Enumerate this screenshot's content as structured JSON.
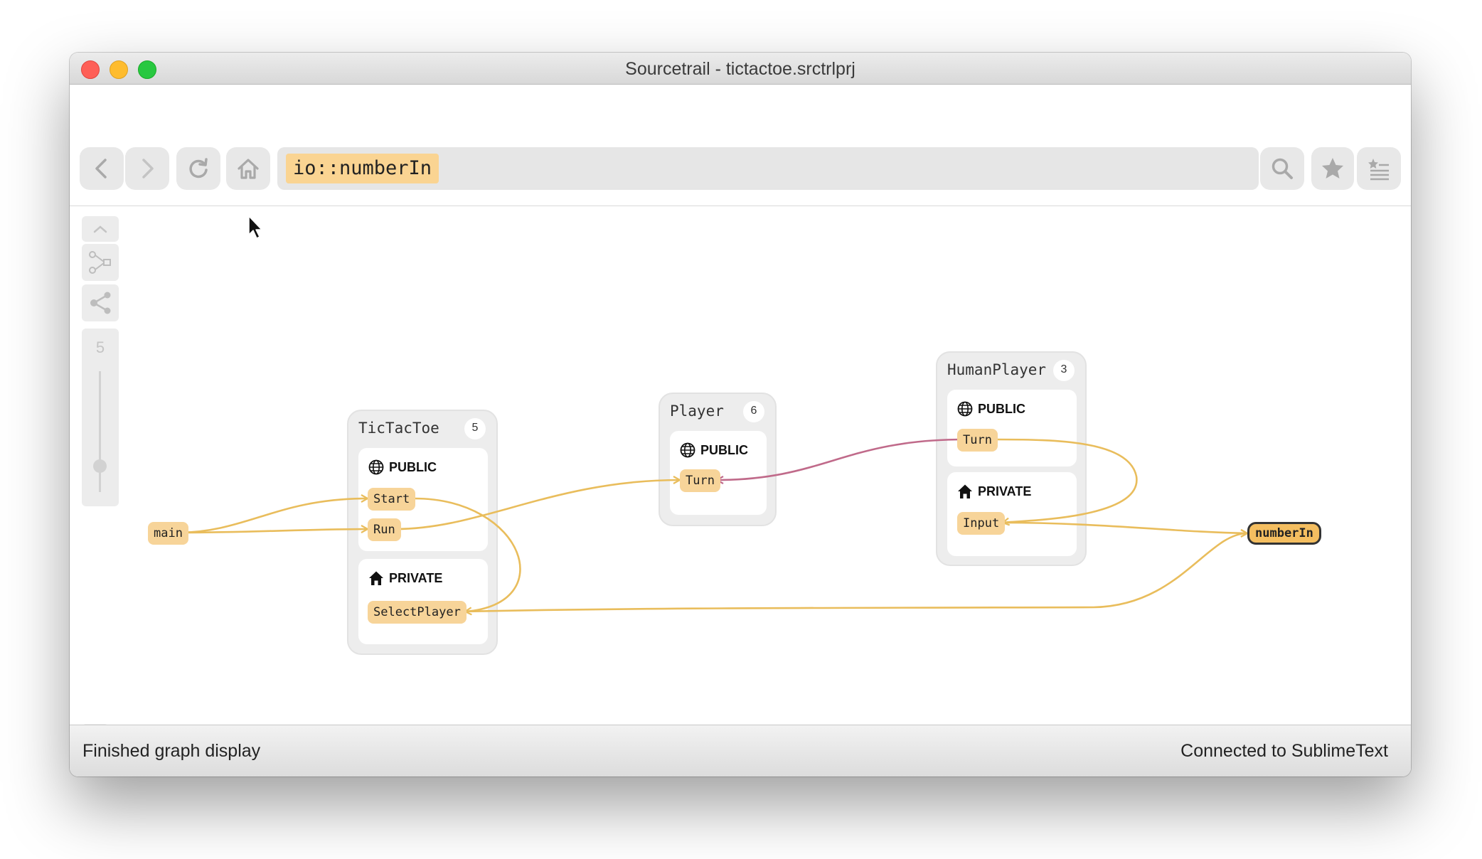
{
  "window": {
    "title": "Sourcetrail - tictactoe.srctrlprj"
  },
  "toolbar": {
    "search_token": "io::numberIn",
    "icons": [
      "back-icon",
      "forward-icon",
      "refresh-icon",
      "home-icon",
      "search-icon",
      "bookmark-icon",
      "bookmark-list-icon"
    ]
  },
  "graph_controls": {
    "depth": "5"
  },
  "graph": {
    "main_node": "main",
    "target_node": "numberIn",
    "tictactoe": {
      "title": "TicTacToe",
      "count": "5",
      "public_label": "PUBLIC",
      "private_label": "PRIVATE",
      "members": {
        "start": "Start",
        "run": "Run",
        "select_player": "SelectPlayer"
      }
    },
    "player": {
      "title": "Player",
      "count": "6",
      "public_label": "PUBLIC",
      "members": {
        "turn": "Turn"
      }
    },
    "human_player": {
      "title": "HumanPlayer",
      "count": "3",
      "public_label": "PUBLIC",
      "private_label": "PRIVATE",
      "members": {
        "turn": "Turn",
        "input": "Input"
      }
    },
    "colors": {
      "call_edge": "#e9bd5c",
      "override_edge": "#c06a8a",
      "node_fill": "#f7d499",
      "active_fill": "#f4be60"
    }
  },
  "status": {
    "left": "Finished graph display",
    "right": "Connected to SublimeText"
  }
}
